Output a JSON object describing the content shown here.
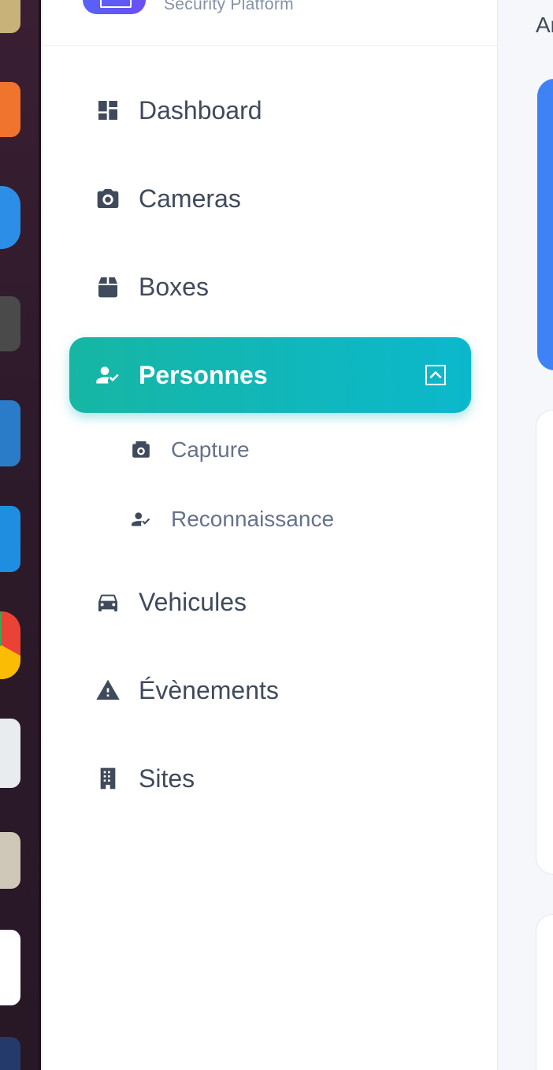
{
  "brand": {
    "subtitle": "Security Platform"
  },
  "content": {
    "heading_fragment": "Ar"
  },
  "nav": {
    "dashboard": "Dashboard",
    "cameras": "Cameras",
    "boxes": "Boxes",
    "personnes": "Personnes",
    "capture": "Capture",
    "reconnaissance": "Reconnaissance",
    "vehicules": "Vehicules",
    "evenements": "Évènements",
    "sites": "Sites"
  },
  "icons": {
    "dashboard": "dashboard-icon",
    "cameras": "camera-icon",
    "boxes": "box-icon",
    "personnes": "person-check-icon",
    "capture": "camera-capture-icon",
    "reconnaissance": "person-check-icon",
    "vehicules": "car-icon",
    "evenements": "warning-icon",
    "sites": "building-icon",
    "expand": "chevron-up-icon"
  },
  "colors": {
    "active_start": "#17b6a4",
    "active_end": "#0bb8cc",
    "text": "#3f4a5c",
    "subtext": "#65738a",
    "accent_blue": "#3f82f5"
  }
}
